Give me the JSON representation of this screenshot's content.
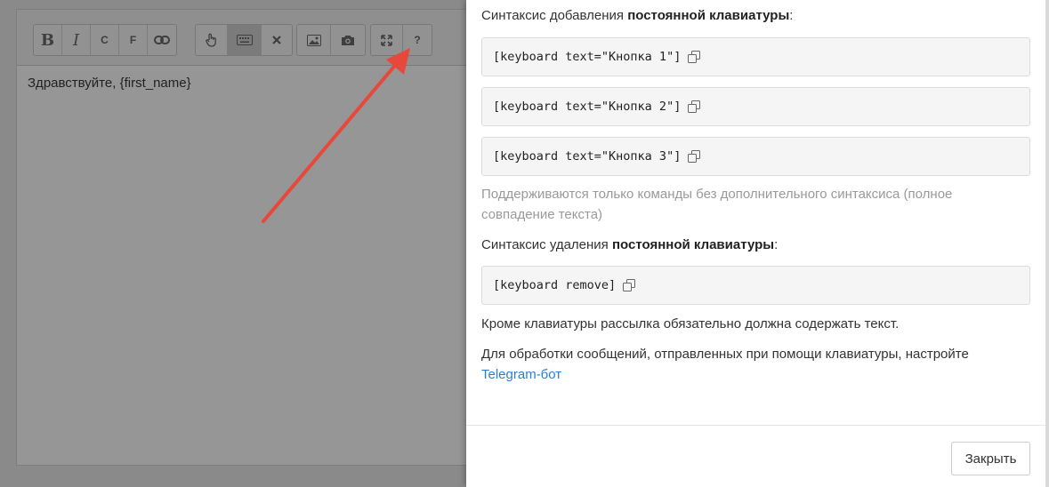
{
  "editor": {
    "text": "Здравствуйте, {first_name}",
    "toolbar": {
      "bold_label": "B",
      "italic_label": "I",
      "c_label": "C",
      "f_label": "F",
      "help_label": "?"
    }
  },
  "modal": {
    "add_prefix": "Синтаксис добавления ",
    "add_bold": "постоянной клавиатуры",
    "add_suffix": ":",
    "codes": [
      "[keyboard text=\"Кнопка 1\"]",
      "[keyboard text=\"Кнопка 2\"]",
      "[keyboard text=\"Кнопка 3\"]"
    ],
    "note_line1": "Поддерживаются только команды без дополнительного синтаксиса (полное",
    "note_line2": "совпадение текста)",
    "remove_prefix": "Синтаксис удаления ",
    "remove_bold": "постоянной клавиатуры",
    "remove_suffix": ":",
    "remove_code": "[keyboard remove]",
    "text_required": "Кроме клавиатуры рассылка обязательно должна содержать текст.",
    "bot_hint": "Для обработки сообщений, отправленных при помощи клавиатуры, настройте",
    "bot_link": "Telegram-бот",
    "close_label": "Закрыть"
  },
  "colors": {
    "overlay": "#8a8a8a",
    "arrow": "#e8473b",
    "link": "#2a7fd0",
    "code_bg": "#f5f5f5"
  }
}
